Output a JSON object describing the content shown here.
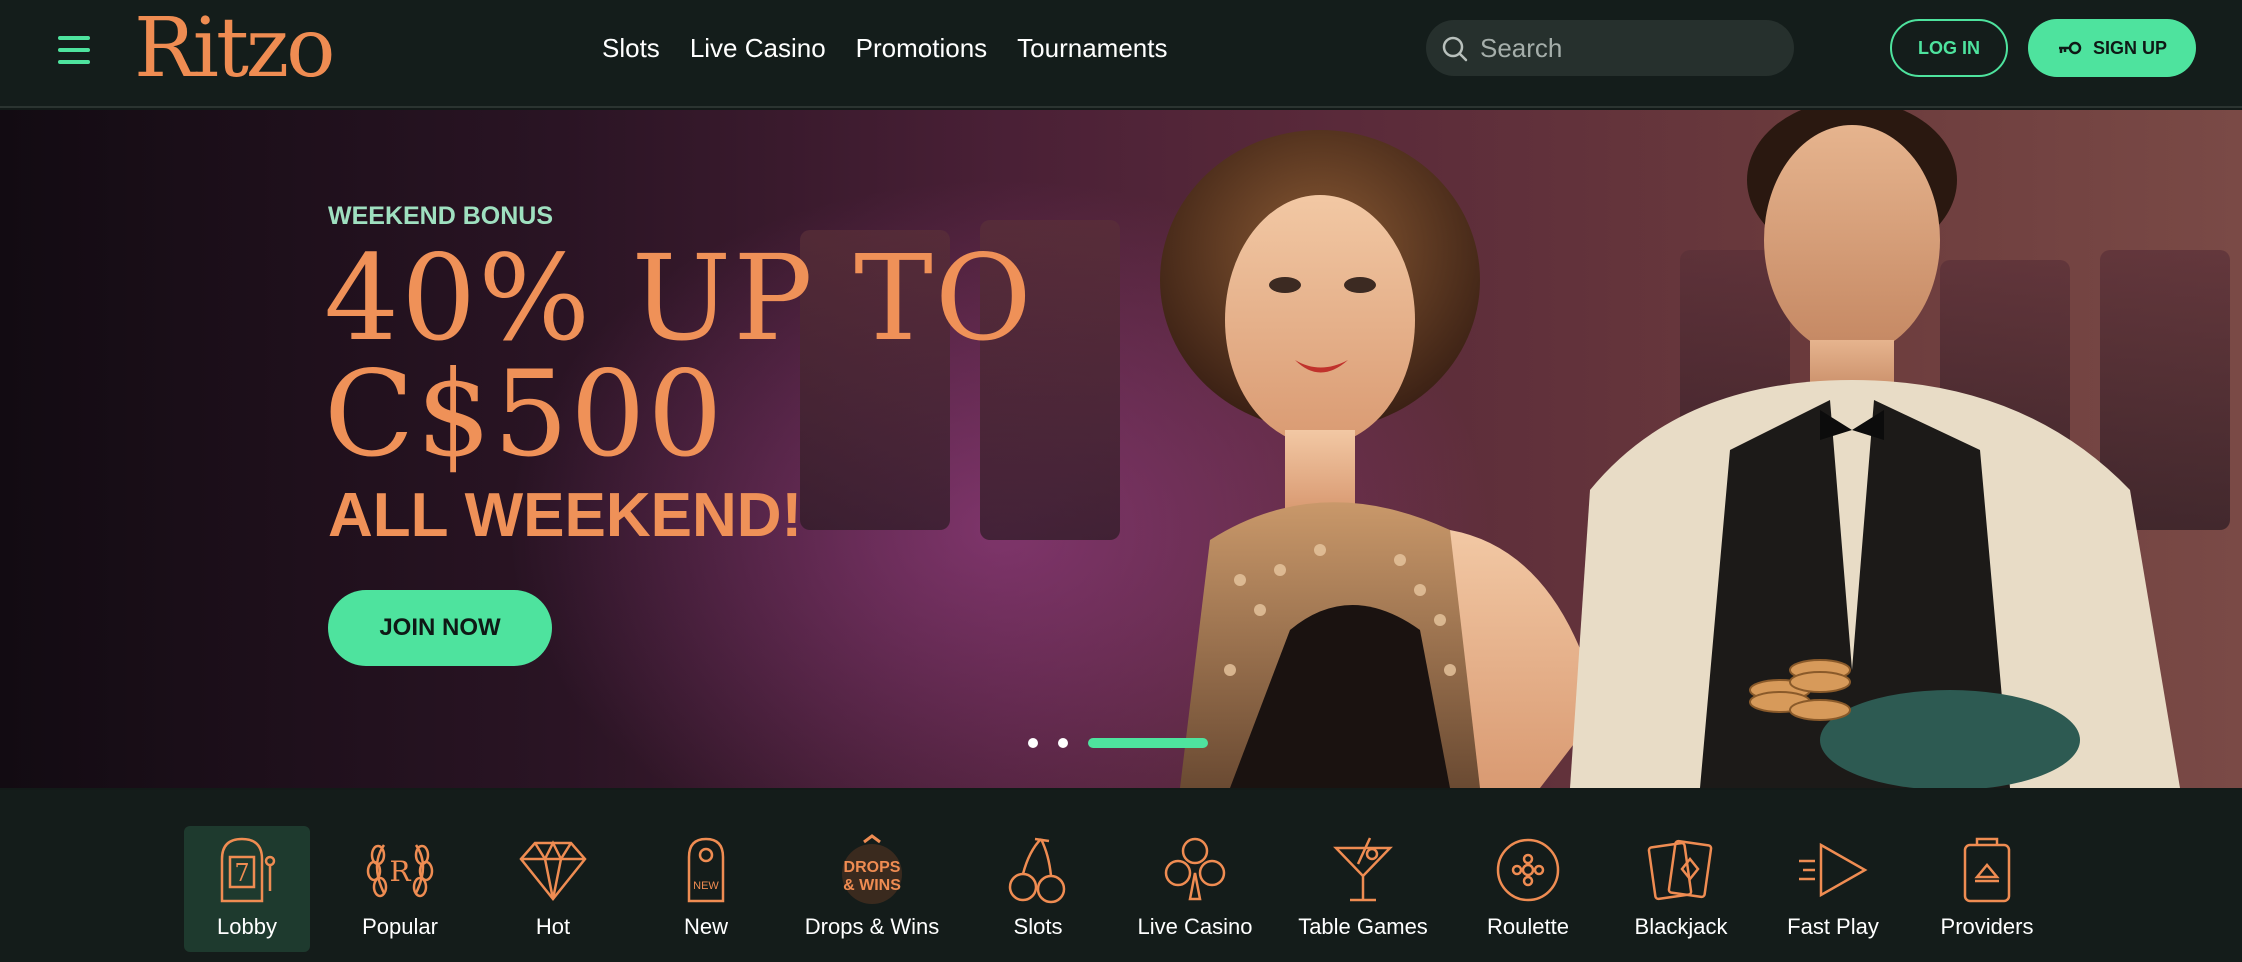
{
  "header": {
    "logo_text": "Ritzo",
    "nav": [
      "Slots",
      "Live Casino",
      "Promotions",
      "Tournaments"
    ],
    "search_placeholder": "Search",
    "login_label": "LOG IN",
    "signup_label": "SIGN UP"
  },
  "hero": {
    "kicker": "WEEKEND BONUS",
    "title_line1": "40% UP TO",
    "title_line2": "C$500",
    "subtitle": "ALL WEEKEND!",
    "cta_label": "JOIN NOW",
    "slide_count": 3,
    "active_slide": 3
  },
  "categories": [
    {
      "label": "Lobby",
      "icon": "slot-machine-icon",
      "active": true
    },
    {
      "label": "Popular",
      "icon": "laurel-r-icon",
      "active": false
    },
    {
      "label": "Hot",
      "icon": "diamond-icon",
      "active": false
    },
    {
      "label": "New",
      "icon": "door-hanger-icon",
      "active": false
    },
    {
      "label": "Drops & Wins",
      "icon": "drops-wins-icon",
      "active": false
    },
    {
      "label": "Slots",
      "icon": "cherries-icon",
      "active": false
    },
    {
      "label": "Live Casino",
      "icon": "club-icon",
      "active": false
    },
    {
      "label": "Table Games",
      "icon": "cocktail-icon",
      "active": false
    },
    {
      "label": "Roulette",
      "icon": "roulette-icon",
      "active": false
    },
    {
      "label": "Blackjack",
      "icon": "cards-icon",
      "active": false
    },
    {
      "label": "Fast Play",
      "icon": "fast-play-icon",
      "active": false
    },
    {
      "label": "Providers",
      "icon": "providers-icon",
      "active": false
    }
  ],
  "colors": {
    "accent_green": "#4ee39e",
    "brand_orange": "#ef8c52",
    "header_bg": "#141d1b"
  }
}
